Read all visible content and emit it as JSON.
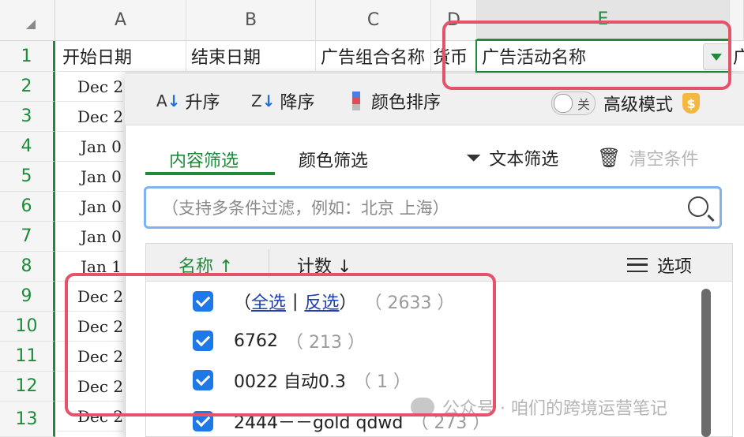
{
  "sheet": {
    "columns": [
      "A",
      "B",
      "C",
      "D",
      "E"
    ],
    "rows": [
      "1",
      "2",
      "3",
      "4",
      "5",
      "6",
      "7",
      "8",
      "9",
      "10",
      "11",
      "12",
      "13"
    ],
    "header_cells": {
      "a1": "开始日期",
      "b1": "结束日期",
      "c1": "广告组合名称",
      "d1": "货币",
      "e1": "广告活动名称",
      "f1": "广"
    },
    "column_a_values": [
      "Dec 2",
      "Dec 2",
      "Jan 0",
      "Jan 0",
      "Jan 0",
      "Jan 0",
      "Jan 1",
      "Dec 2",
      "Dec 2",
      "Dec 2",
      "Dec 2",
      "Dec 2"
    ]
  },
  "filter_panel": {
    "toolbar": {
      "ascending": "升序",
      "descending": "降序",
      "color_sort": "颜色排序",
      "toggle_state": "关",
      "advanced_mode": "高级模式",
      "vip_badge": "$"
    },
    "tabs": {
      "content_filter": "内容筛选",
      "color_filter": "颜色筛选",
      "text_filter": "文本筛选",
      "clear_conditions": "清空条件"
    },
    "search": {
      "placeholder": "（支持多条件过滤，例如：北京  上海）"
    },
    "list_header": {
      "name": "名称",
      "name_sort_arrow": "↑",
      "count": "计数",
      "count_sort_arrow": "↓",
      "options": "选项"
    },
    "items": {
      "open_paren": "（",
      "select_all": "全选",
      "separator": "|",
      "invert_select": "反选",
      "close_paren": "）",
      "total_count": "（ 2633 ）",
      "item1_name": "6762",
      "item1_count": "（ 213 ）",
      "item2_name": "0022 自动0.3",
      "item2_count": "（ 1 ）",
      "item3_name": "2444－－gold qdwd",
      "item3_count": "（ 273 ）"
    }
  },
  "watermark": "公众号 · 咱们的跨境运营笔记",
  "colors": {
    "accent_green": "#1f8a3a",
    "checkbox_blue": "#1e78e8",
    "highlight_red": "#e5536a",
    "link_blue": "#1f3fb6"
  }
}
